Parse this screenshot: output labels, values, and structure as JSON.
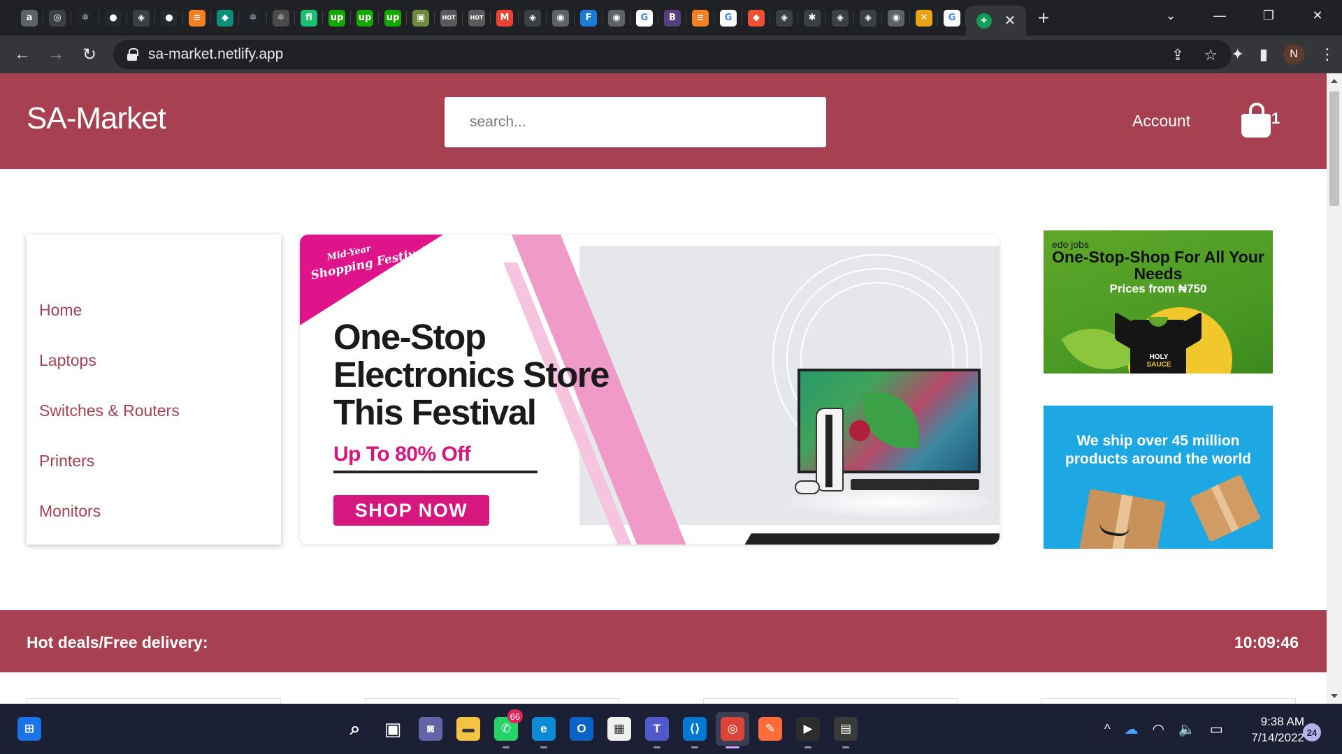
{
  "browser": {
    "tabs": [
      {
        "icon": "amazon-icon",
        "glyph": "a",
        "bg": "#5f6368"
      },
      {
        "icon": "chrome-icon",
        "glyph": "◎",
        "bg": "#3c4043"
      },
      {
        "icon": "react-icon",
        "glyph": "⚛",
        "bg": "#20232a"
      },
      {
        "icon": "github-icon",
        "glyph": "●",
        "bg": "#24292f"
      },
      {
        "icon": "netlify-icon",
        "glyph": "◈",
        "bg": "#3c4043"
      },
      {
        "icon": "github-icon",
        "glyph": "●",
        "bg": "#24292f"
      },
      {
        "icon": "stackoverflow-icon",
        "glyph": "≡",
        "bg": "#f48024"
      },
      {
        "icon": "diamond-icon",
        "glyph": "◆",
        "bg": "#0b8f7d"
      },
      {
        "icon": "react-icon",
        "glyph": "⚛",
        "bg": "#20232a"
      },
      {
        "icon": "react-icon",
        "glyph": "⚛",
        "bg": "#4a4a4a"
      },
      {
        "icon": "fiverr-icon",
        "glyph": "fi",
        "bg": "#1dbf73"
      },
      {
        "icon": "upwork-icon",
        "glyph": "up",
        "bg": "#14a800"
      },
      {
        "icon": "upwork-icon",
        "glyph": "up",
        "bg": "#14a800"
      },
      {
        "icon": "upwork-icon",
        "glyph": "up",
        "bg": "#14a800"
      },
      {
        "icon": "image-icon",
        "glyph": "▣",
        "bg": "#6f8a3a"
      },
      {
        "icon": "hot-icon",
        "glyph": "HOT",
        "bg": "#5a5a5a"
      },
      {
        "icon": "hot-icon",
        "glyph": "HOT",
        "bg": "#5a5a5a"
      },
      {
        "icon": "gmail-icon",
        "glyph": "M",
        "bg": "#ea4335"
      },
      {
        "icon": "netlify-icon",
        "glyph": "◈",
        "bg": "#3c4043"
      },
      {
        "icon": "globe-icon",
        "glyph": "◉",
        "bg": "#5f6368"
      },
      {
        "icon": "f-icon",
        "glyph": "F",
        "bg": "#1d7bd8"
      },
      {
        "icon": "globe-icon",
        "glyph": "◉",
        "bg": "#5f6368"
      },
      {
        "icon": "google-icon",
        "glyph": "G",
        "bg": "#ffffff"
      },
      {
        "icon": "bootstrap-icon",
        "glyph": "B",
        "bg": "#563d7c"
      },
      {
        "icon": "stackoverflow-icon",
        "glyph": "≡",
        "bg": "#f48024"
      },
      {
        "icon": "google-icon",
        "glyph": "G",
        "bg": "#ffffff"
      },
      {
        "icon": "git-icon",
        "glyph": "◆",
        "bg": "#f05033"
      },
      {
        "icon": "netlify-icon",
        "glyph": "◈",
        "bg": "#3c4043"
      },
      {
        "icon": "bug-icon",
        "glyph": "✱",
        "bg": "#3c4043"
      },
      {
        "icon": "netlify-icon",
        "glyph": "◈",
        "bg": "#3c4043"
      },
      {
        "icon": "netlify-icon",
        "glyph": "◈",
        "bg": "#3c4043"
      },
      {
        "icon": "globe-icon",
        "glyph": "◉",
        "bg": "#5f6368"
      },
      {
        "icon": "xd-icon",
        "glyph": "✕",
        "bg": "#e8a317"
      },
      {
        "icon": "google-icon",
        "glyph": "G",
        "bg": "#ffffff"
      }
    ],
    "active_tab": {
      "icon": "plus-circle-icon",
      "glyph": "+",
      "bg": "#0f9d58",
      "close": "✕"
    },
    "new_tab": "+",
    "window": {
      "dropdown": "⌄",
      "minimize": "—",
      "restore": "❐",
      "close": "✕"
    },
    "nav": {
      "back": "←",
      "forward": "→",
      "reload": "↻"
    },
    "url": "sa-market.netlify.app",
    "omnibox_icons": {
      "share": "⇪",
      "star": "☆"
    },
    "toolbar_icons": {
      "extensions": "✦",
      "sidepanel": "▮",
      "profile": "N",
      "menu": "⋮"
    }
  },
  "header": {
    "logo": "SA-Market",
    "search_placeholder": "search...",
    "account": "Account",
    "cart_count": "1"
  },
  "sidebar": {
    "items": [
      "Home",
      "Laptops",
      "Switches & Routers",
      "Printers",
      "Monitors"
    ]
  },
  "hero": {
    "festival_line1": "Mid-Year",
    "festival_line2": "Shopping Festival",
    "headline": "One-Stop Electronics Store This Festival",
    "offer": "Up To 80% Off",
    "cta": "SHOP NOW"
  },
  "ads": {
    "green": {
      "brand": "edo jobs",
      "title": "One-Stop-Shop For All Your Needs",
      "subtitle": "Prices from ₦750",
      "shirt_line1": "HOLY",
      "shirt_line2": "SAUCE"
    },
    "blue": {
      "title": "We ship over 45 million products around the world"
    }
  },
  "deals": {
    "label": "Hot deals/Free delivery:",
    "timer": "10:09:46"
  },
  "taskbar": {
    "apps": [
      {
        "name": "start",
        "glyph": "⊞",
        "bg": "#1a73e8"
      },
      {
        "name": "search",
        "glyph": "⌕",
        "bg": "transparent"
      },
      {
        "name": "task-view",
        "glyph": "▣",
        "bg": "transparent"
      },
      {
        "name": "chat",
        "glyph": "◙",
        "bg": "#6264a7"
      },
      {
        "name": "file-explorer",
        "glyph": "▬",
        "bg": "#f5c242"
      },
      {
        "name": "whatsapp",
        "glyph": "✆",
        "bg": "#25d366",
        "badge": "66"
      },
      {
        "name": "edge",
        "glyph": "e",
        "bg": "#0c8bd6"
      },
      {
        "name": "outlook",
        "glyph": "O",
        "bg": "#0a64c8"
      },
      {
        "name": "store",
        "glyph": "▦",
        "bg": "#f0f0f0"
      },
      {
        "name": "teams",
        "glyph": "T",
        "bg": "#5059c9"
      },
      {
        "name": "vscode",
        "glyph": "⟨⟩",
        "bg": "#0078d4"
      },
      {
        "name": "chrome",
        "glyph": "◎",
        "bg": "#db4437"
      },
      {
        "name": "postman",
        "glyph": "✎",
        "bg": "#ff6c37"
      },
      {
        "name": "media-player",
        "glyph": "▶",
        "bg": "#2d2d2d"
      },
      {
        "name": "calculator",
        "glyph": "▤",
        "bg": "#3a3a3a"
      }
    ],
    "active_app": "chrome",
    "tray": {
      "chevron": "^",
      "onedrive": "☁",
      "wifi": "◠",
      "volume": "🔈",
      "battery": "▭"
    },
    "time": "9:38 AM",
    "date": "7/14/2022",
    "notifications": "24"
  },
  "colors": {
    "brand": "#a74152",
    "hero_pink": "#d6177f"
  }
}
